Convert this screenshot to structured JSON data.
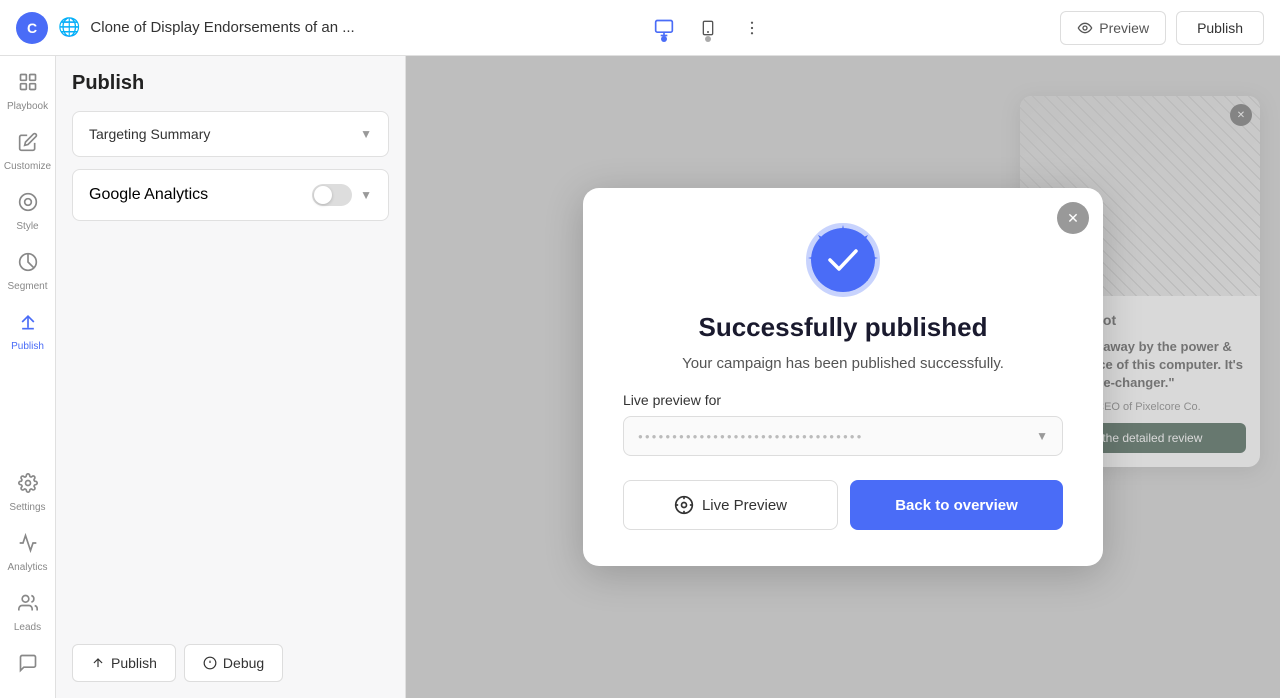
{
  "topbar": {
    "logo_initial": "C",
    "title": "Clone of Display Endorsements of an ...",
    "preview_label": "Preview",
    "publish_label": "Publish"
  },
  "sidebar": {
    "items": [
      {
        "id": "playbook",
        "label": "Playbook",
        "icon": "⊞"
      },
      {
        "id": "customize",
        "label": "Customize",
        "icon": "✏️"
      },
      {
        "id": "style",
        "label": "Style",
        "icon": "🎨"
      },
      {
        "id": "segment",
        "label": "Segment",
        "icon": "◎"
      },
      {
        "id": "publish",
        "label": "Publish",
        "icon": "🚀",
        "active": true
      },
      {
        "id": "settings",
        "label": "Settings",
        "icon": "⚙️"
      },
      {
        "id": "analytics",
        "label": "Analytics",
        "icon": "📊"
      },
      {
        "id": "leads",
        "label": "Leads",
        "icon": "👥"
      }
    ],
    "bottom_icon": "💬"
  },
  "panel": {
    "title": "Publish",
    "targeting_summary_label": "Targeting Summary",
    "google_analytics_label": "Google Analytics",
    "toggle_state": "off",
    "footer_publish_label": "Publish",
    "footer_debug_label": "Debug"
  },
  "modal": {
    "title": "Successfully published",
    "description": "Your campaign has been published successfully.",
    "live_preview_for_label": "Live preview for",
    "select_placeholder": "●●●●●●●●●●●●●●●●●●●●●●●●●●●●●●●●●",
    "live_preview_label": "Live Preview",
    "back_to_overview_label": "Back to overview"
  },
  "trustpilot_card": {
    "logo_star": "★",
    "logo_name": "Trustpilot",
    "quote": "\"I'm blown away by the power & performance of this computer. It's truly a game-changer.\"",
    "author": "-Avery Blair, CEO of Pixelcore Co.",
    "cta_label": "See the detailed review"
  }
}
